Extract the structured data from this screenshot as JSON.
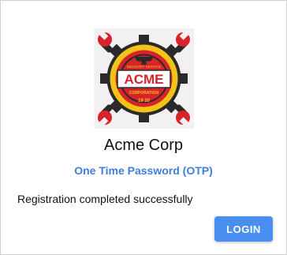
{
  "logo": {
    "icon": "acme-corp-logo",
    "text_main": "ACME",
    "text_top": "INDUSTRY SERVICE",
    "text_bottom": "CORPORATION",
    "year": "19 20"
  },
  "organization": {
    "name": "Acme Corp"
  },
  "otp": {
    "title": "One Time Password (OTP)"
  },
  "status": {
    "message": "Registration completed successfully"
  },
  "actions": {
    "login_label": "LOGIN"
  },
  "colors": {
    "accent": "#3f7fdc",
    "button": "#4a8ef0",
    "logo_red": "#d8232a",
    "logo_yellow": "#f3c417",
    "logo_dark": "#2a2a2a"
  }
}
